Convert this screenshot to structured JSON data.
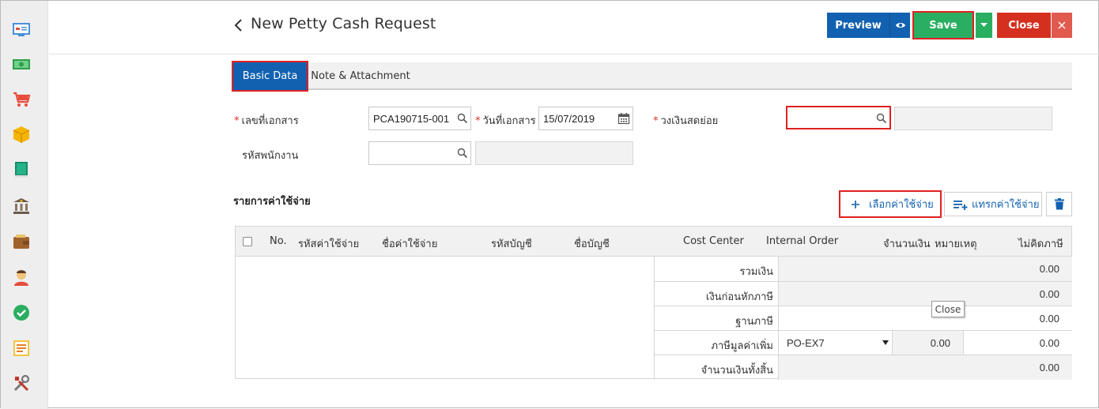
{
  "header": {
    "title": "New Petty Cash Request",
    "preview_label": "Preview",
    "save_label": "Save",
    "close_label": "Close"
  },
  "tabs": [
    {
      "label": "Basic Data",
      "active": true
    },
    {
      "label": "Note & Attachment",
      "active": false
    }
  ],
  "form": {
    "doc_no_label": "เลขที่เอกสาร",
    "doc_no_value": "PCA190715-001",
    "doc_date_label": "วันที่เอกสาร",
    "doc_date_value": "15/07/2019",
    "petty_fund_label": "วงเงินสดย่อย",
    "petty_fund_value": "",
    "employee_label": "รหัสพนักงาน",
    "employee_value": ""
  },
  "expenses": {
    "section_title": "รายการค่าใช้จ่าย",
    "select_button": "เลือกค่าใช้จ่าย",
    "insert_button": "แทรกค่าใช้จ่าย",
    "columns": [
      "No.",
      "รหัสค่าใช้จ่าย",
      "ชื่อค่าใช้จ่าย",
      "รหัสบัญชี",
      "ชื่อบัญชี",
      "Cost Center",
      "Internal Order",
      "จำนวนเงิน",
      "หมายเหตุ",
      "ไม่คิดภาษี"
    ]
  },
  "summary": {
    "total_label": "รวมเงิน",
    "total_value": "0.00",
    "pretax_label": "เงินก่อนหักภาษี",
    "pretax_value": "0.00",
    "taxbase_label": "ฐานภาษี",
    "taxbase_value": "0.00",
    "vat_label": "ภาษีมูลค่าเพิ่ม",
    "vat_code": "PO-EX7",
    "vat_rate": "0.00",
    "vat_value": "0.00",
    "grand_label": "จำนวนเงินทั้งสิ้น",
    "grand_value": "0.00"
  },
  "tooltip": "Close",
  "colors": {
    "primary": "#1261b1",
    "success": "#2aae61",
    "danger": "#d5301f",
    "highlight": "#e02020"
  }
}
